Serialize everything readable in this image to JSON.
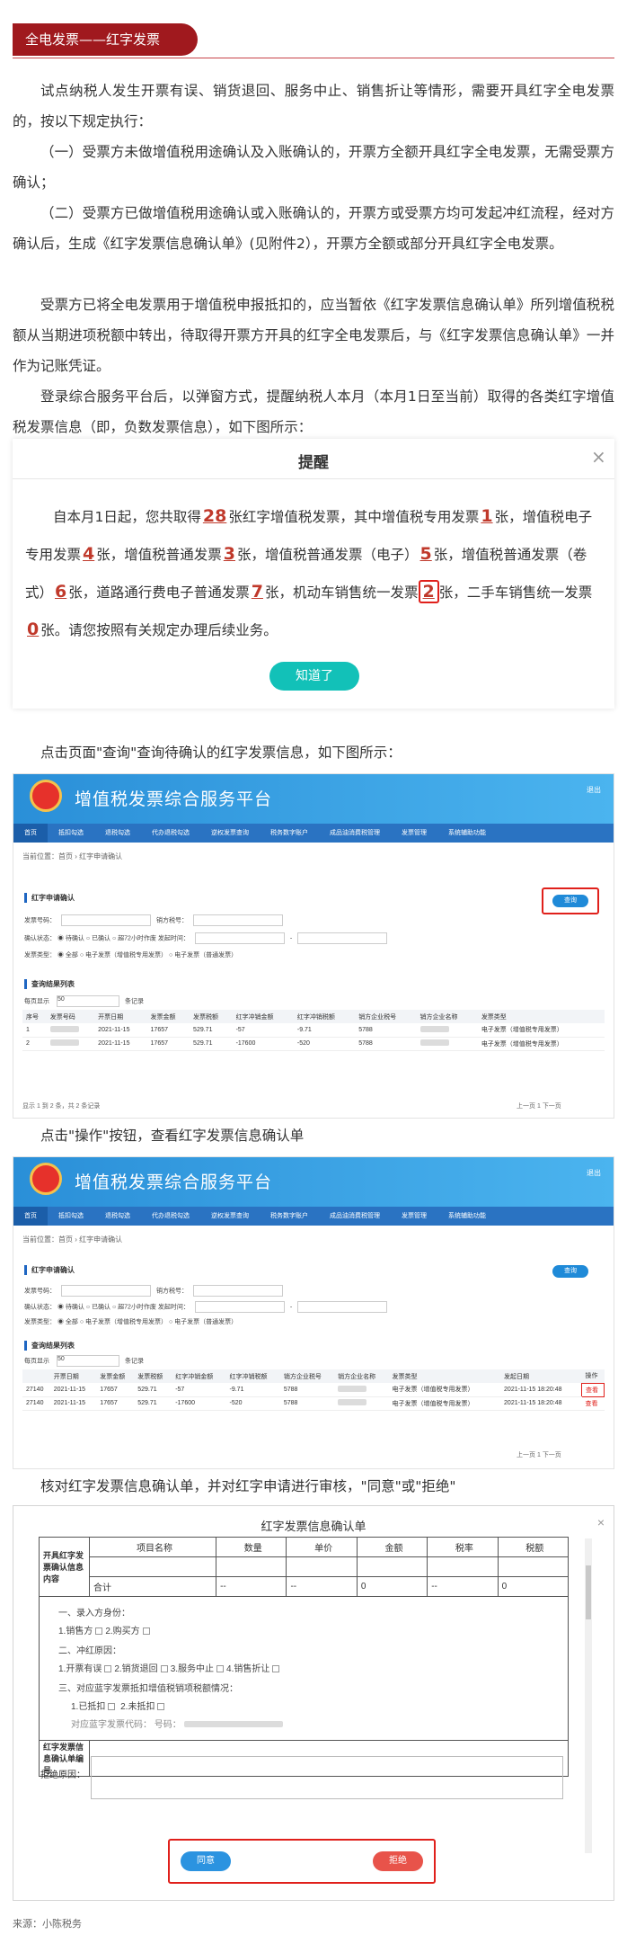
{
  "header": {
    "title": "全电发票——红字发票"
  },
  "paragraphs": [
    "试点纳税人发生开票有误、销货退回、服务中止、销售折让等情形，需要开具红字全电发票的，按以下规定执行：",
    "（一）受票方未做增值税用途确认及入账确认的，开票方全额开具红字全电发票，无需受票方确认；",
    "（二）受票方已做增值税用途确认或入账确认的，开票方或受票方均可发起冲红流程，经对方确认后，生成《红字发票信息确认单》(见附件2），开票方全额或部分开具红字全电发票。",
    "受票方已将全电发票用于增值税申报抵扣的，应当暂依《红字发票信息确认单》所列增值税税额从当期进项税额中转出，待取得开票方开具的红字全电发票后，与《红字发票信息确认单》一并作为记账凭证。",
    "登录综合服务平台后，以弹窗方式，提醒纳税人本月（本月1日至当前）取得的各类红字增值税发票信息（即，负数发票信息），如下图所示："
  ],
  "popup": {
    "title": "提醒",
    "close": "×",
    "t1": "自本月1日起，您共取得",
    "n_total": "28",
    "t2": "张红字增值税发票，其中增值税专用发票",
    "n_special": "1",
    "t3": "张，增值税电子专用发票",
    "n_e_special": "4",
    "t4": "张，增值税普通发票",
    "n_normal": "3",
    "t5": "张，增值税普通发票（电子）",
    "n_e_normal": "5",
    "t6": "张，增值税普通发票（卷式）",
    "n_roll": "6",
    "t7": "张，道路通行费电子普通发票",
    "n_toll": "7",
    "t8": "张，机动车销售统一发票",
    "n_vehicle": "2",
    "t9": "张，二手车销售统一发票",
    "n_used": "0",
    "t10": "张。请您按照有关规定办理后续业务。",
    "ok": "知道了"
  },
  "caption1": "点击页面\"查询\"查询待确认的红字发票信息，如下图所示：",
  "caption2": "点击\"操作\"按钮，查看红字发票信息确认单",
  "caption3": "核对红字发票信息确认单，并对红字申请进行审核，\"同意\"或\"拒绝\"",
  "platform": {
    "title": "增值税发票综合服务平台",
    "user": "退出",
    "nav": [
      "首页",
      "抵扣勾选",
      "退税勾选",
      "代办退税勾选",
      "逆权发票查询",
      "税务数字账户",
      "成品油消费税管理",
      "发票管理",
      "系统辅助功能"
    ],
    "crumb": "当前位置：首页 › 红字申请确认",
    "panel1": "红字申请确认",
    "query": "查询",
    "f_no": "发票号码：",
    "f_seller": "销方税号：",
    "f_status": "确认状态：",
    "opt1": "待确认",
    "opt2": "已确认",
    "opt3": "超72小时作废",
    "f_time": "发起时间：",
    "f_type": "发票类型：",
    "t_all": "全部",
    "t_spec": "电子发票（增值税专用发票）",
    "t_norm": "电子发票（普通发票）",
    "panel2": "查询结果列表",
    "per_page": "每页显示",
    "per_val": "50",
    "unit": "条记录",
    "cols": [
      "序号",
      "发票号码",
      "开票日期",
      "发票金额",
      "发票税额",
      "红字冲销金额",
      "红字冲销税额",
      "销方企业税号",
      "销方企业名称",
      "发票类型"
    ],
    "rows": [
      [
        "1",
        "",
        "2021-11-15",
        "17657",
        "529.71",
        "-57",
        "-9.71",
        "5788",
        "",
        "电子发票（增值税专用发票）"
      ],
      [
        "2",
        "",
        "2021-11-15",
        "17657",
        "529.71",
        "-17600",
        "-520",
        "5788",
        "",
        "电子发票（增值税专用发票）"
      ]
    ],
    "summary": "显示 1 到 2 条，共 2 条记录",
    "prev": "上一页",
    "page": "1",
    "next": "下一页",
    "cols2": [
      "",
      "开票日期",
      "发票金额",
      "发票税额",
      "红字冲销金额",
      "红字冲销税额",
      "销方企业税号",
      "销方企业名称",
      "发票类型",
      "发起日期",
      "操作"
    ],
    "rows2": [
      [
        "27140",
        "2021-11-15",
        "17657",
        "529.71",
        "-57",
        "-9.71",
        "5788",
        "",
        "电子发票（增值税专用发票）",
        "2021-11-15 18:20:48",
        "查看"
      ],
      [
        "27140",
        "2021-11-15",
        "17657",
        "529.71",
        "-17600",
        "-520",
        "5788",
        "",
        "电子发票（增值税专用发票）",
        "2021-11-15 18:20:48",
        "查看"
      ]
    ]
  },
  "dialog": {
    "title": "红字发票信息确认单",
    "close": "×",
    "h_content": "开具红字发票确认信息内容",
    "h_name": "项目名称",
    "h_qty": "数量",
    "h_price": "单价",
    "h_amount": "金额",
    "h_rate": "税率",
    "h_tax": "税额",
    "total": "合计",
    "dash": "--",
    "zero": "0",
    "s1": "一、录入方身份：",
    "s1a": "1.销售方",
    "s1b": "2.购买方",
    "s2": "二、冲红原因：",
    "s2a": "1.开票有误",
    "s2b": "2.销货退回",
    "s2c": "3.服务中止",
    "s2d": "4.销售折让",
    "s3": "三、对应蓝字发票抵扣增值税销项税额情况：",
    "s3a": "1.已抵扣",
    "s3b": "2.未抵扣",
    "s3c": "对应蓝字发票代码：",
    "s3d": "号码：",
    "h_no": "红字发票信息确认单编号",
    "reject_reason": "拒绝原因：",
    "agree": "同意",
    "reject": "拒绝"
  },
  "source": "来源：小陈税务"
}
